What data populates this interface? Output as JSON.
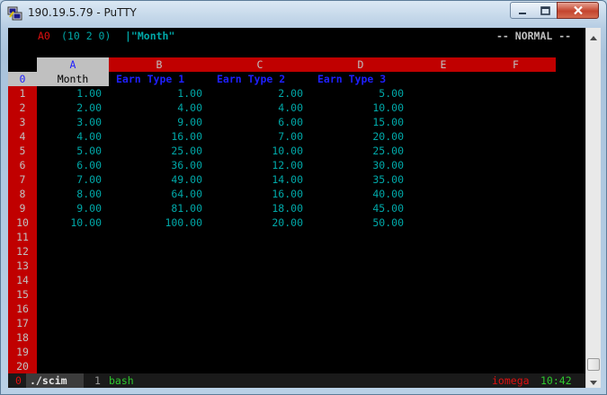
{
  "window": {
    "title": "190.19.5.79 - PuTTY"
  },
  "editor": {
    "cell_ref": "A0",
    "cell_format": "(10 2 0)",
    "cell_content": "|\"Month\"",
    "mode": "-- NORMAL --"
  },
  "columns": [
    "A",
    "B",
    "C",
    "D",
    "E",
    "F"
  ],
  "header_row": {
    "row_number": "0",
    "cells": [
      "Month",
      "Earn Type 1",
      "Earn Type 2",
      "Earn Type 3"
    ]
  },
  "rows": [
    {
      "n": "1",
      "cells": [
        "1.00",
        "1.00",
        "2.00",
        "5.00"
      ]
    },
    {
      "n": "2",
      "cells": [
        "2.00",
        "4.00",
        "4.00",
        "10.00"
      ]
    },
    {
      "n": "3",
      "cells": [
        "3.00",
        "9.00",
        "6.00",
        "15.00"
      ]
    },
    {
      "n": "4",
      "cells": [
        "4.00",
        "16.00",
        "7.00",
        "20.00"
      ]
    },
    {
      "n": "5",
      "cells": [
        "5.00",
        "25.00",
        "10.00",
        "25.00"
      ]
    },
    {
      "n": "6",
      "cells": [
        "6.00",
        "36.00",
        "12.00",
        "30.00"
      ]
    },
    {
      "n": "7",
      "cells": [
        "7.00",
        "49.00",
        "14.00",
        "35.00"
      ]
    },
    {
      "n": "8",
      "cells": [
        "8.00",
        "64.00",
        "16.00",
        "40.00"
      ]
    },
    {
      "n": "9",
      "cells": [
        "9.00",
        "81.00",
        "18.00",
        "45.00"
      ]
    },
    {
      "n": "10",
      "cells": [
        "10.00",
        "100.00",
        "20.00",
        "50.00"
      ]
    },
    {
      "n": "11",
      "cells": []
    },
    {
      "n": "12",
      "cells": []
    },
    {
      "n": "13",
      "cells": []
    },
    {
      "n": "14",
      "cells": []
    },
    {
      "n": "15",
      "cells": []
    },
    {
      "n": "16",
      "cells": []
    },
    {
      "n": "17",
      "cells": []
    },
    {
      "n": "18",
      "cells": []
    },
    {
      "n": "19",
      "cells": []
    },
    {
      "n": "20",
      "cells": []
    }
  ],
  "tmux": {
    "window0_index": "0",
    "window0_name": "./scim",
    "window1_index": "1",
    "window1_name": "bash",
    "hostname": "iomega",
    "time": "10:42"
  },
  "colors": {
    "terminal_bg": "#000000",
    "header_red": "#c00000",
    "value_cyan": "#00a8a8",
    "label_blue": "#1f1fff",
    "status_green": "#2ec82e"
  },
  "icons": {
    "app": "putty-icon",
    "minimize": "minimize-icon",
    "maximize": "maximize-icon",
    "close": "close-icon"
  }
}
